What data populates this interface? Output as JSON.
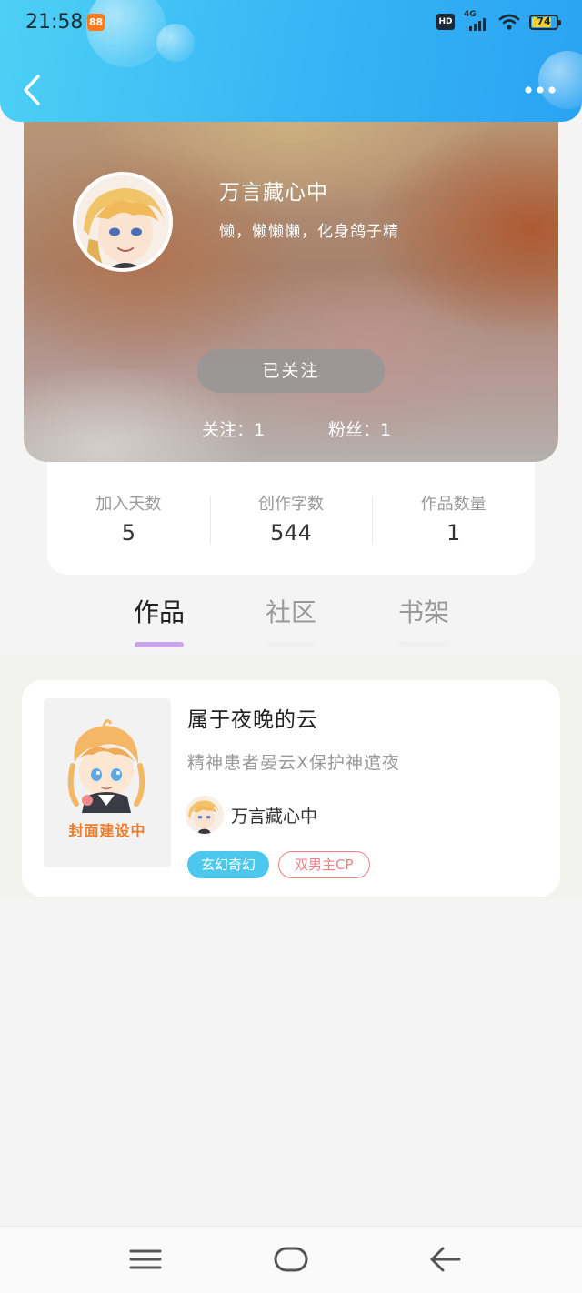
{
  "status_bar": {
    "time": "21:58",
    "app_badge_text": "88",
    "hd_label": "HD",
    "network_label": "4G",
    "battery_level": "74",
    "battery_color": "#ffcf2e"
  },
  "header": {
    "back_icon": "chevron-left-icon",
    "more_icon": "more-dots-icon",
    "gradient_colors": [
      "#4dd0f5",
      "#2aa3f2"
    ]
  },
  "profile": {
    "username": "万言藏心中",
    "bio": "懒，懒懒懒，化身鸽子精",
    "follow_button": "已关注",
    "following_text": "关注：1",
    "followers_text": "粉丝：1"
  },
  "stats": [
    {
      "label": "加入天数",
      "value": "5"
    },
    {
      "label": "创作字数",
      "value": "544"
    },
    {
      "label": "作品数量",
      "value": "1"
    }
  ],
  "tabs": [
    {
      "label": "作品",
      "active": true
    },
    {
      "label": "社区",
      "active": false
    },
    {
      "label": "书架",
      "active": false
    }
  ],
  "works": [
    {
      "cover_label": "封面建设中",
      "title": "属于夜晚的云",
      "description": "精神患者晏云X保护神逭夜",
      "author": "万言藏心中",
      "tags": [
        "玄幻奇幻",
        "双男主CP"
      ],
      "tag_colors": [
        "#4cc8ee",
        "#ef7f87"
      ]
    }
  ],
  "nav_bar": {
    "icons": [
      "menu-icon",
      "home-icon",
      "back-arrow-icon"
    ]
  }
}
